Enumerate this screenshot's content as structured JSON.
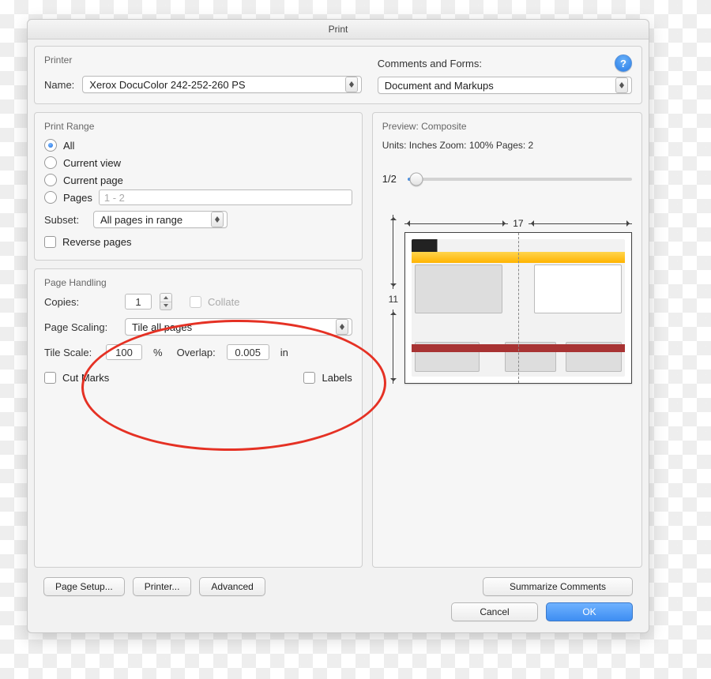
{
  "window": {
    "title": "Print"
  },
  "printer": {
    "group_title": "Printer",
    "name_label": "Name:",
    "name_value": "Xerox DocuColor 242-252-260 PS",
    "comments_label": "Comments and Forms:",
    "comments_value": "Document and Markups"
  },
  "range": {
    "group_title": "Print Range",
    "all": "All",
    "current_view": "Current view",
    "current_page": "Current page",
    "pages": "Pages",
    "pages_placeholder": "1 - 2",
    "subset_label": "Subset:",
    "subset_value": "All pages in range",
    "reverse": "Reverse pages"
  },
  "handling": {
    "group_title": "Page Handling",
    "copies_label": "Copies:",
    "copies_value": "1",
    "collate": "Collate",
    "page_scaling_label": "Page Scaling:",
    "page_scaling_value": "Tile all pages",
    "tile_scale_label": "Tile Scale:",
    "tile_scale_value": "100",
    "percent": "%",
    "overlap_label": "Overlap:",
    "overlap_value": "0.005",
    "overlap_unit": "in",
    "cut_marks": "Cut Marks",
    "labels": "Labels"
  },
  "preview": {
    "group_title": "Preview: Composite",
    "units_line": "Units: Inches Zoom: 100% Pages: 2",
    "page_indicator": "1/2",
    "width": "17",
    "height": "11"
  },
  "buttons": {
    "page_setup": "Page Setup...",
    "printer": "Printer...",
    "advanced": "Advanced",
    "summarize": "Summarize Comments",
    "cancel": "Cancel",
    "ok": "OK"
  },
  "help_glyph": "?"
}
